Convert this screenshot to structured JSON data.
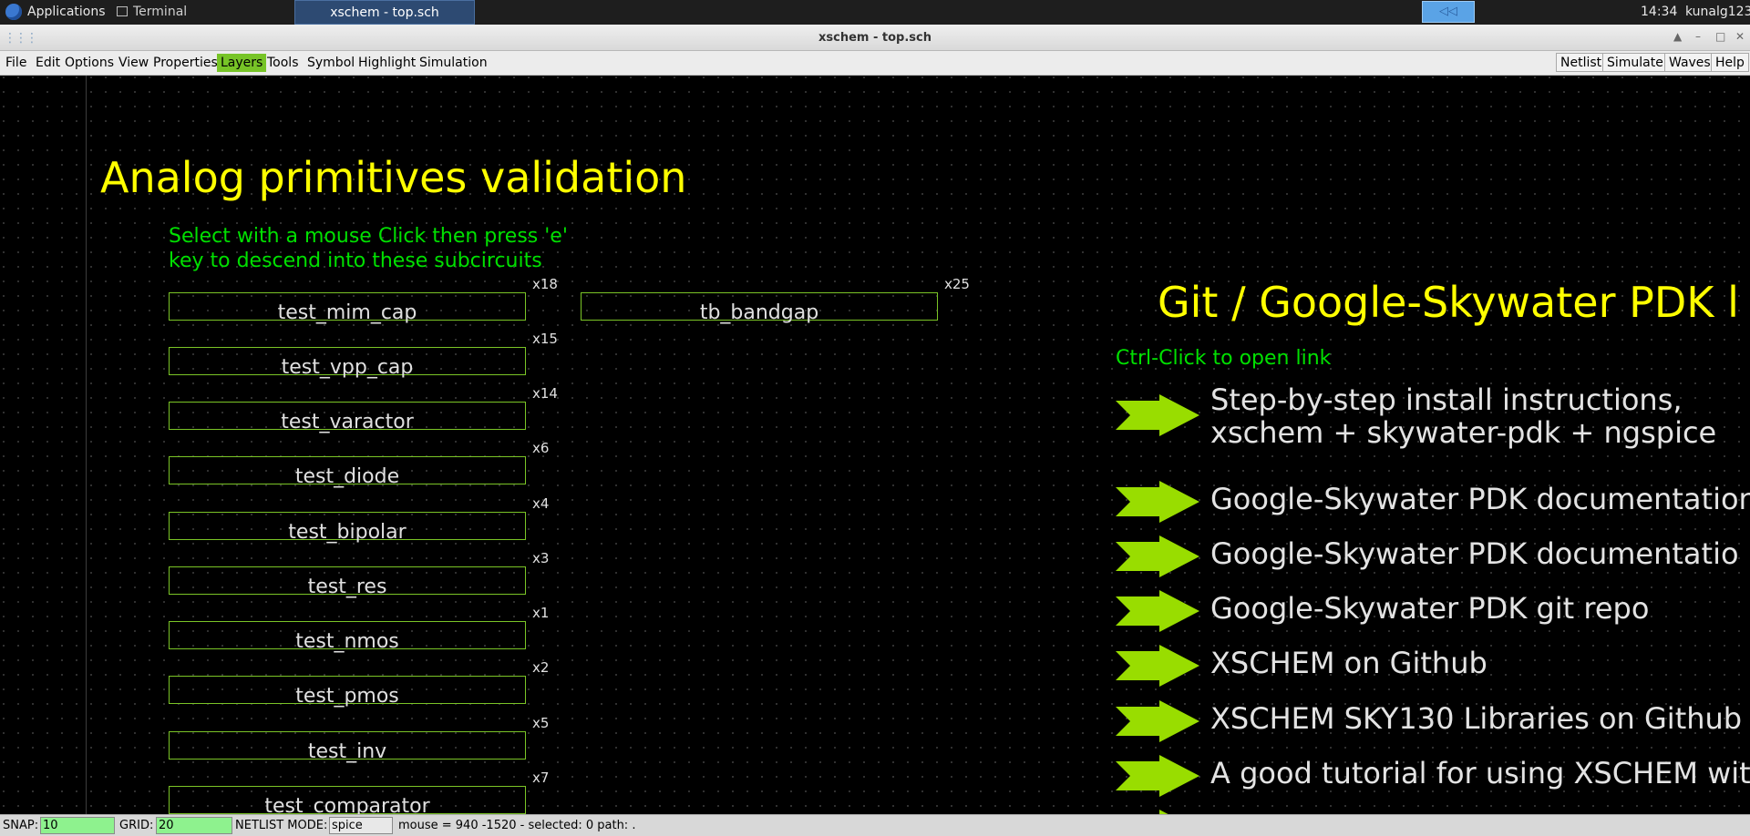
{
  "taskbar": {
    "applications": "Applications",
    "terminal": "Terminal",
    "active_window": "xschem - top.sch",
    "time": "14:34",
    "user": "kunalg123"
  },
  "window": {
    "title": "xschem - top.sch"
  },
  "menu": {
    "items": [
      "File",
      "Edit",
      "Options",
      "View",
      "Properties",
      "Layers",
      "Tools",
      "Symbol",
      "Highlight",
      "Simulation"
    ],
    "active": "Layers",
    "active_color": "#77c427",
    "buttons": [
      "Netlist",
      "Simulate",
      "Waves",
      "Help"
    ]
  },
  "canvas": {
    "title": "Analog primitives validation",
    "instructions": [
      "Select with a mouse Click then press 'e'",
      "key to descend into these subcircuits"
    ],
    "symbols": [
      {
        "name": "test_mim_cap",
        "instance": "x18"
      },
      {
        "name": "test_vpp_cap",
        "instance": "x15"
      },
      {
        "name": "test_varactor",
        "instance": "x14"
      },
      {
        "name": "test_diode",
        "instance": "x6"
      },
      {
        "name": "test_bipolar",
        "instance": "x4"
      },
      {
        "name": "test_res",
        "instance": "x3"
      },
      {
        "name": "test_nmos",
        "instance": "x1"
      },
      {
        "name": "test_pmos",
        "instance": "x2"
      },
      {
        "name": "test_inv",
        "instance": "x5"
      },
      {
        "name": "test_comparator",
        "instance": "x7"
      },
      {
        "name": "tb_bandgap",
        "instance": "x25"
      }
    ],
    "git_title": "Git / Google-Skywater PDK l",
    "ctrl_click": "Ctrl-Click to open link",
    "links": [
      [
        "Step-by-step install instructions,",
        "xschem + skywater-pdk + ngspice"
      ],
      [
        "Google-Skywater PDK documentation"
      ],
      [
        "Google-Skywater PDK documentatio"
      ],
      [
        "Google-Skywater PDK git repo"
      ],
      [
        "XSCHEM on Github"
      ],
      [
        "XSCHEM SKY130 Libraries on Github"
      ],
      [
        "A good tutorial for using XSCHEM witl"
      ]
    ],
    "colors": {
      "background": "#000000",
      "title": "#ffff00",
      "instruction": "#00e000",
      "symbol_border": "#7ac426",
      "arrow": "#99dd00",
      "text": "#e0e0e0"
    }
  },
  "status": {
    "snap_label": "SNAP:",
    "snap": "10",
    "grid_label": "GRID:",
    "grid": "20",
    "netlist_mode_label": "NETLIST MODE:",
    "netlist_mode": "spice",
    "info": "mouse = 940 -1520 - selected: 0 path: ."
  }
}
